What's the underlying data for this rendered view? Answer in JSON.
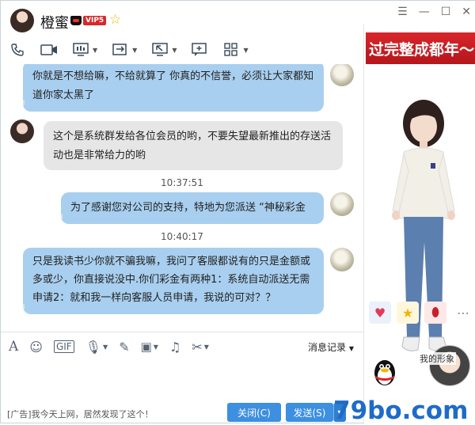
{
  "contact": {
    "name": "橙蜜",
    "vip_label": "VIP5"
  },
  "window_controls": [
    "☰",
    "—",
    "☐",
    "✕"
  ],
  "toolbar_icons": [
    "phone-icon",
    "video-icon",
    "screen-share-icon",
    "file-transfer-icon",
    "remote-desktop-icon",
    "add-contact-icon",
    "apps-grid-icon"
  ],
  "messages": [
    {
      "side": "right",
      "type": "blue",
      "text": "你就是不想给嘛，不给就算了 你真的不信誉，必须让大家都知道你家太黑了"
    },
    {
      "side": "left",
      "type": "gray",
      "text": "这个是系统群发给各位会员的哟，不要失望最新推出的存送活动也是非常给力的哟"
    },
    {
      "time": "10:37:51"
    },
    {
      "side": "right",
      "type": "blue",
      "text": "为了感谢您对公司的支持，特地为您派送 “神秘彩金"
    },
    {
      "time": "10:40:17"
    },
    {
      "side": "right",
      "type": "blue",
      "text": "只是我读书少你就不骗我嘛，我问了客服都说有的只是金额或多或少，你直接说没中.你们彩金有两种1：系统自动派送无需申请2：就和我一样向客服人员申请，我说的可对？？"
    }
  ],
  "input_toolbar": {
    "icons": [
      "font-icon",
      "emoji-icon",
      "gif-icon",
      "mic-icon",
      "pen-icon",
      "image-icon",
      "music-icon",
      "scissors-icon"
    ],
    "history_label": "消息记录"
  },
  "footer": {
    "ad_text": "[广告]我今天上网，居然发现了这个！",
    "close_label": "关闭(C)",
    "send_label": "发送(S)"
  },
  "right_panel": {
    "banner_text": "过完整成都年～",
    "my_avatar_label": "我的形象"
  },
  "watermark": "79bo.com",
  "colors": {
    "blue_bubble": "#a8cfef",
    "gray_bubble": "#e6e6e6",
    "button_blue": "#3d8fe0",
    "banner_red": "#d8262b"
  }
}
